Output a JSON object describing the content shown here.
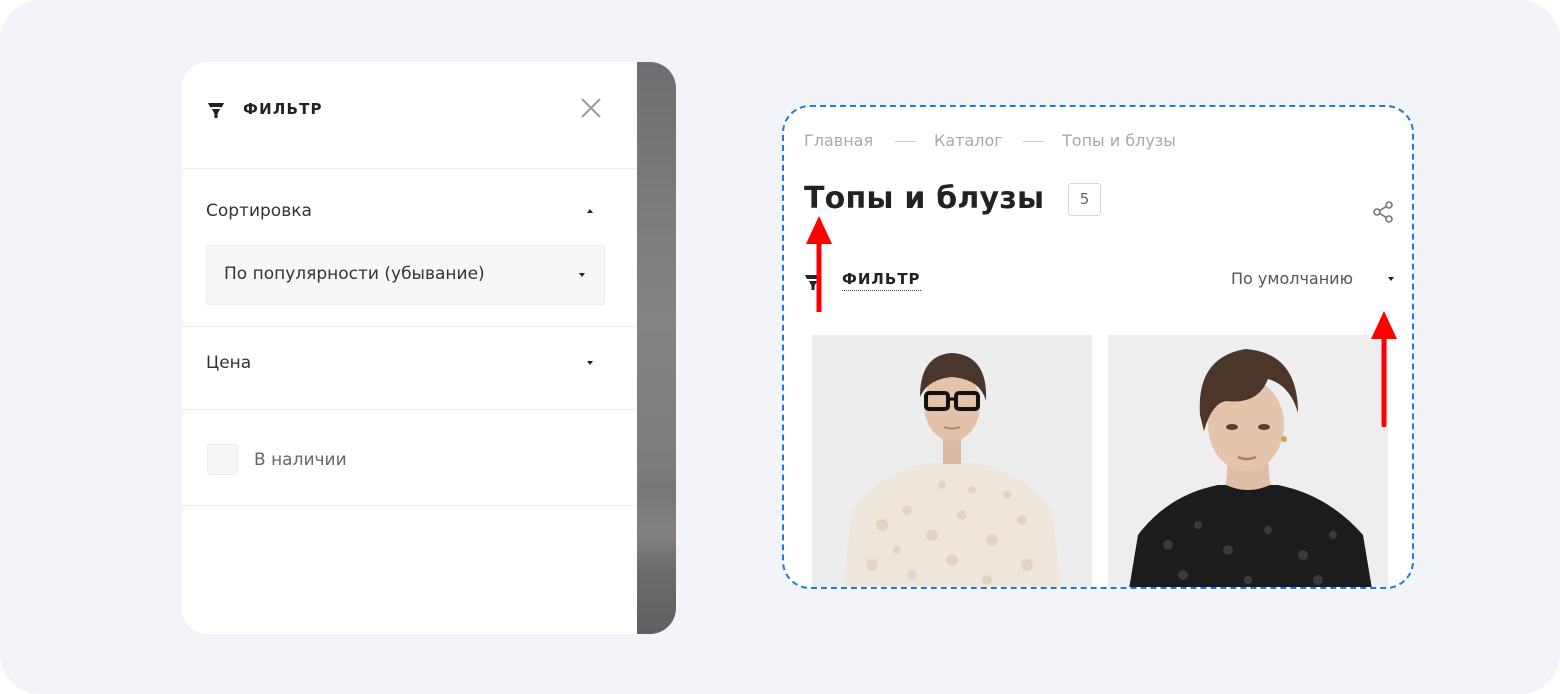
{
  "filter_panel": {
    "title": "ФИЛЬТР",
    "sort": {
      "label": "Сортировка",
      "selected_value": "По популярности (убывание)"
    },
    "price": {
      "label": "Цена"
    },
    "in_stock": {
      "label": "В наличии",
      "checked": false
    }
  },
  "catalog": {
    "breadcrumb": [
      "Главная",
      "Каталог",
      "Топы и блузы"
    ],
    "title": "Топы и блузы",
    "count": "5",
    "filter_label": "ФИЛЬТР",
    "sort_label": "По умолчанию"
  },
  "colors": {
    "annotation_arrow": "#ff0000",
    "frame_border": "#1f7ae0",
    "page_background": "#f3f4f9"
  },
  "icons": [
    "filter-icon",
    "close-icon",
    "share-icon",
    "caret-up-icon",
    "caret-down-icon"
  ]
}
